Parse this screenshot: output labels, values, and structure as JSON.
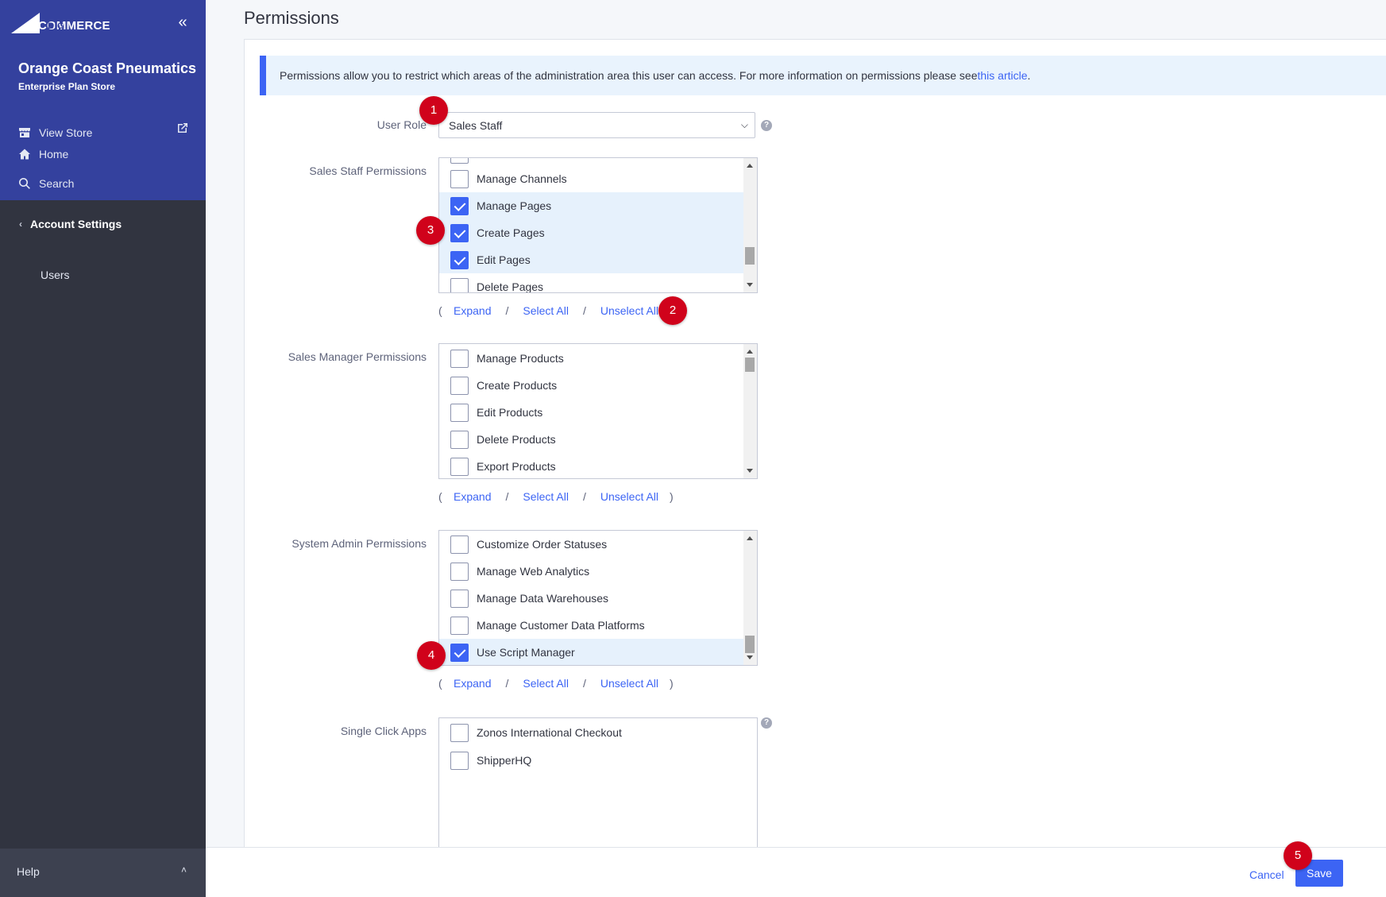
{
  "sidebar": {
    "logo_big": "BIG",
    "logo_text": "COMMERCE",
    "store_name": "Orange Coast Pneumatics",
    "store_plan": "Enterprise Plan Store",
    "nav": {
      "view_store": "View Store",
      "home": "Home",
      "search": "Search"
    },
    "section": "Account Settings",
    "users": "Users",
    "help": "Help"
  },
  "page": {
    "title": "Permissions",
    "banner_text": "Permissions allow you to restrict which areas of the administration area this user can access. For more information on permissions please see ",
    "banner_link": "this article",
    "banner_end": "."
  },
  "user_role": {
    "label": "User Role",
    "value": "Sales Staff"
  },
  "sales_staff": {
    "label": "Sales Staff Permissions",
    "items": [
      {
        "label": "Manage Channels",
        "checked": false
      },
      {
        "label": "Manage Pages",
        "checked": true
      },
      {
        "label": "Create Pages",
        "checked": true
      },
      {
        "label": "Edit Pages",
        "checked": true
      },
      {
        "label": "Delete Pages",
        "checked": false
      }
    ]
  },
  "sales_manager": {
    "label": "Sales Manager Permissions",
    "items": [
      {
        "label": "Manage Products",
        "checked": false
      },
      {
        "label": "Create Products",
        "checked": false
      },
      {
        "label": "Edit Products",
        "checked": false
      },
      {
        "label": "Delete Products",
        "checked": false
      },
      {
        "label": "Export Products",
        "checked": false
      }
    ]
  },
  "system_admin": {
    "label": "System Admin Permissions",
    "items": [
      {
        "label": "Customize Order Statuses",
        "checked": false
      },
      {
        "label": "Manage Web Analytics",
        "checked": false
      },
      {
        "label": "Manage Data Warehouses",
        "checked": false
      },
      {
        "label": "Manage Customer Data Platforms",
        "checked": false
      },
      {
        "label": "Use Script Manager",
        "checked": true
      }
    ]
  },
  "single_click": {
    "label": "Single Click Apps",
    "items": [
      {
        "label": "Zonos International Checkout",
        "checked": false
      },
      {
        "label": "ShipperHQ",
        "checked": false
      }
    ]
  },
  "actions": {
    "open_paren": "(",
    "expand": "Expand",
    "slash": "/",
    "select_all": "Select All",
    "unselect_all": "Unselect All",
    "close_paren": ")"
  },
  "help_mark": "?",
  "badges": [
    "1",
    "2",
    "3",
    "4",
    "5"
  ],
  "footer": {
    "cancel": "Cancel",
    "save": "Save"
  },
  "colors": {
    "accent": "#3c64f4",
    "sidebar_top": "#34419e",
    "sidebar_bg": "#313440",
    "checked_row": "#e6f1fc",
    "badge": "#d0021b"
  }
}
